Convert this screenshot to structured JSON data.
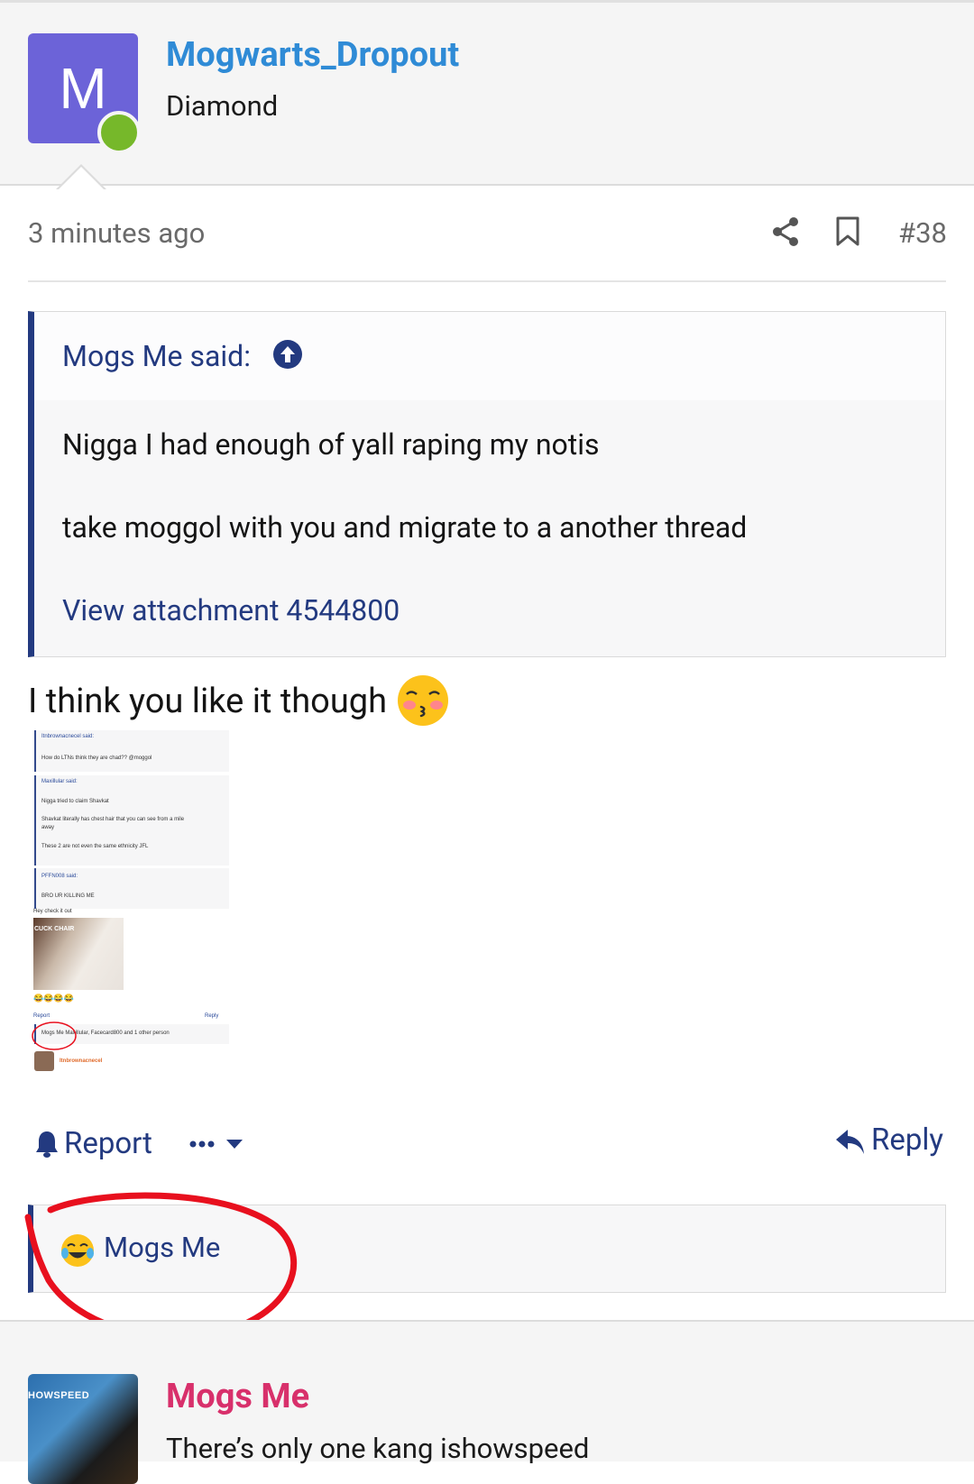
{
  "post": {
    "avatar_letter": "M",
    "username": "Mogwarts_Dropout",
    "user_title": "Diamond",
    "time": "3 minutes ago",
    "post_number": "#38",
    "quote": {
      "author": "Mogs Me said:",
      "line1": "Nigga I had enough of yall raping my notis",
      "line2": "take moggol with you and migrate to a another thread",
      "attachment_link": "View attachment 4544800"
    },
    "body_text": "I think you like it though",
    "body_emoji": "kissing-face-with-closed-eyes",
    "thumbnail": {
      "q1_author": "Itnbrownacnecel said:",
      "q1_text": "How do LTNs think they are chad?? @moggol",
      "q2_author": "Maxillular said:",
      "q2_line1": "Nigga tried to claim Shavkat",
      "q2_line2": "Shavkat literally has chest hair that you can see from a mile",
      "q2_line3": "away",
      "q2_line4": "These 2 are not even the same ethnicity JFL",
      "q3_author": "PFFN008 said:",
      "q3_text": "BRO UR KILLING ME",
      "hey": "Hey check it out",
      "img_caption": "CUCK CHAIR",
      "report": "Report",
      "reply": "Reply",
      "reactions": "Mogs Me Maxillular, Facecard800 and 1 other person",
      "next_user": "Itnbrownacnecel"
    },
    "actions": {
      "report_label": "Report",
      "reply_label": "Reply"
    },
    "reactions": {
      "emoji": "joy-emoji",
      "name": "Mogs Me"
    }
  },
  "next_post": {
    "avatar_tag": "HOWSPEED",
    "username": "Mogs Me",
    "subtitle": "There’s only one kang ishowspeed"
  },
  "colors": {
    "username_blue": "#2f8bd6",
    "link_navy": "#233a80",
    "next_username_pink": "#d8306b",
    "online_green": "#76b82a",
    "annotation_red": "#e8101e"
  }
}
